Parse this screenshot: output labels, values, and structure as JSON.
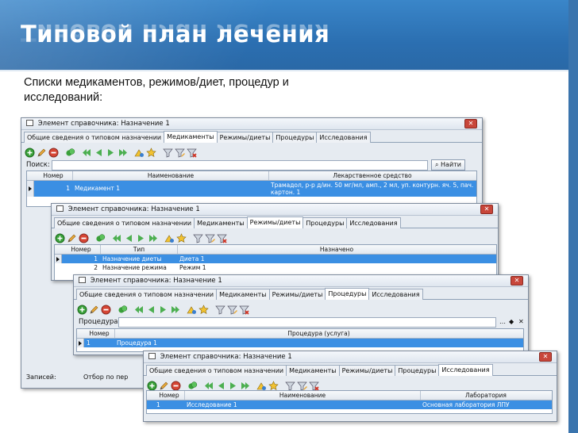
{
  "slide": {
    "title": "Типовой план лечения",
    "subtitle": "Списки медикаментов, режимов/диет, процедур и исследований:"
  },
  "toolbar_icons": [
    "add-icon",
    "edit-icon",
    "delete-icon",
    "copy-icon",
    "first-icon",
    "prev-icon",
    "next-icon",
    "last-icon",
    "refresh-icon",
    "favorites-icon",
    "filter-icon",
    "filter-edit-icon",
    "filter-clear-icon"
  ],
  "windows": {
    "w1": {
      "title": "Элемент справочника: Назначение 1",
      "tabs": [
        "Общие сведения о типовом назначении",
        "Медикаменты",
        "Режимы/диеты",
        "Процедуры",
        "Исследования"
      ],
      "search_label": "Поиск:",
      "find_button": "Найти",
      "columns": [
        "Номер",
        "Наименование",
        "Лекарственное средство"
      ],
      "row": {
        "num": "1",
        "name": "Медикамент 1",
        "drug_line1": "Трамадол, р-р д/ин. 50 мг/мл, амп., 2 мл, уп. контурн. яч. 5, пач.",
        "drug_line2": "картон. 1"
      },
      "records_label": "Записей:",
      "selected_label": "Отбор по пер"
    },
    "w2": {
      "title": "Элемент справочника: Назначение 1",
      "tabs": [
        "Общие сведения о типовом назначении",
        "Медикаменты",
        "Режимы/диеты",
        "Процедуры",
        "Исследования"
      ],
      "columns": [
        "Номер",
        "Тип",
        "Назначено"
      ],
      "row": {
        "num": "1",
        "type": "Назначение диеты",
        "assigned": "Диета 1"
      },
      "row2": {
        "num": "2",
        "type": "Назначение режима",
        "assigned": "Режим 1"
      }
    },
    "w3": {
      "title": "Элемент справочника: Назначение 1",
      "tabs": [
        "Общие сведения о типовом назначении",
        "Медикаменты",
        "Режимы/диеты",
        "Процедуры",
        "Исследования"
      ],
      "proc_label": "Процедура:",
      "columns": [
        "Номер",
        "Процедура (услуга)"
      ],
      "row": {
        "num": "1",
        "name": "Процедура 1"
      }
    },
    "w4": {
      "title": "Элемент справочника: Назначение 1",
      "tabs": [
        "Общие сведения о типовом назначении",
        "Медикаменты",
        "Режимы/диеты",
        "Процедуры",
        "Исследования"
      ],
      "columns": [
        "Номер",
        "Наименование",
        "Лаборатория"
      ],
      "row": {
        "num": "1",
        "name": "Исследование 1",
        "lab": "Основная лаборатория ЛПУ"
      }
    }
  }
}
